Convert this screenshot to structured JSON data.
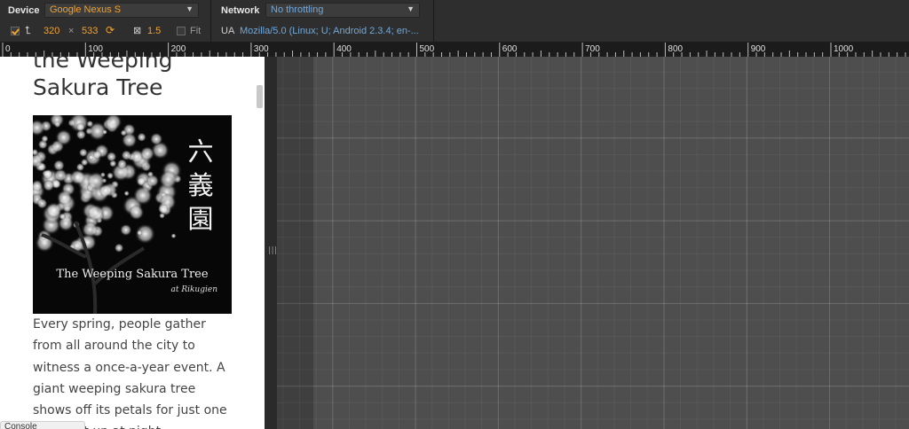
{
  "toolbar": {
    "device_label": "Device",
    "device_value": "Google Nexus S",
    "network_label": "Network",
    "network_value": "No throttling",
    "width": "320",
    "times": "×",
    "height": "533",
    "scale": "1.5",
    "fit_label": "Fit",
    "ua_label": "UA",
    "ua_value": "Mozilla/5.0 (Linux; U; Android 2.3.4; en-..."
  },
  "ruler": {
    "labels": [
      "0",
      "100",
      "200",
      "300",
      "400",
      "500",
      "600",
      "700",
      "800",
      "900",
      "1000"
    ]
  },
  "page": {
    "title": "the Weeping Sakura Tree",
    "poster_jp": "六義園",
    "poster_name": "The Weeping Sakura Tree",
    "poster_location": "at Rikugien",
    "body": "Every spring, people gather from all around the city to witness a once-a-year event. A giant weeping sakura tree shows off its petals for just one week. Lit up at night..."
  },
  "console_tab": "Console",
  "colors": {
    "accent_orange": "#f3a22b",
    "accent_blue": "#6fa8dc",
    "toolbar_bg": "#2e2e2e",
    "canvas_bg": "#4e4e4e"
  },
  "icons": [
    "checkbox-checked-icon",
    "swap-dimensions-icon",
    "rotate-icon",
    "scale-icon",
    "dropdown-arrow-icon",
    "resize-grip-icon"
  ]
}
